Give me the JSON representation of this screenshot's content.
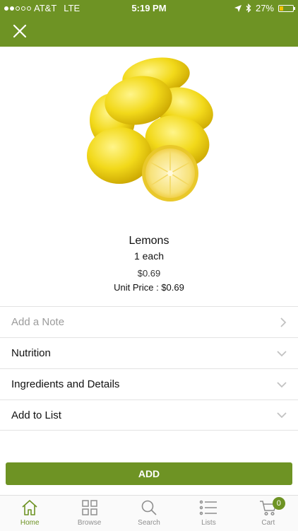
{
  "status_bar": {
    "carrier": "AT&T",
    "network": "LTE",
    "time": "5:19 PM",
    "battery": "27%",
    "battery_level": 0.27
  },
  "product": {
    "name": "Lemons",
    "size": "1 each",
    "price": "$0.69",
    "unit_price": "Unit Price : $0.69"
  },
  "rows": [
    {
      "label": "Add a Note",
      "icon": "chevron-right-icon"
    },
    {
      "label": "Nutrition",
      "icon": "chevron-down-icon"
    },
    {
      "label": "Ingredients and Details",
      "icon": "chevron-down-icon"
    },
    {
      "label": "Add to List",
      "icon": "chevron-down-icon"
    }
  ],
  "add_button": "ADD",
  "tabs": [
    {
      "label": "Home",
      "icon": "home-icon",
      "active": true
    },
    {
      "label": "Browse",
      "icon": "grid-icon"
    },
    {
      "label": "Search",
      "icon": "search-icon"
    },
    {
      "label": "Lists",
      "icon": "list-icon"
    },
    {
      "label": "Cart",
      "icon": "cart-icon",
      "badge": "0"
    }
  ],
  "colors": {
    "brand": "#6e9324",
    "battery": "#f5c000"
  }
}
